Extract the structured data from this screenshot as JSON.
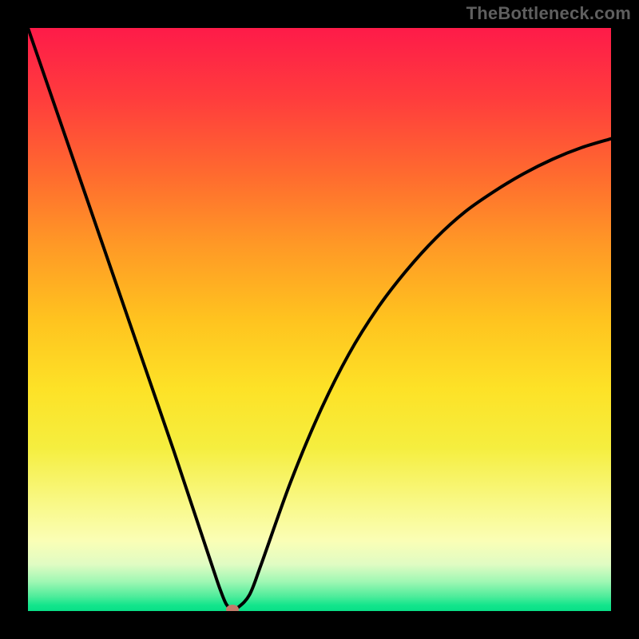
{
  "watermark": "TheBottleneck.com",
  "chart_data": {
    "type": "line",
    "title": "",
    "xlabel": "",
    "ylabel": "",
    "xlim": [
      0,
      100
    ],
    "ylim": [
      0,
      100
    ],
    "grid": false,
    "legend": false,
    "series": [
      {
        "name": "bottleneck-curve",
        "x": [
          0,
          5,
          10,
          15,
          20,
          25,
          28,
          30,
          32,
          33,
          34,
          35,
          36,
          38,
          40,
          45,
          50,
          55,
          60,
          65,
          70,
          75,
          80,
          85,
          90,
          95,
          100
        ],
        "values": [
          100,
          85.5,
          71,
          56.5,
          42,
          27.5,
          18.5,
          12.5,
          6.5,
          3.6,
          1.2,
          0.3,
          0.6,
          2.8,
          8,
          22,
          34,
          44,
          52,
          58.5,
          64,
          68.5,
          72,
          75,
          77.5,
          79.5,
          81
        ]
      }
    ],
    "marker": {
      "name": "bottleneck-point",
      "x": 35,
      "y": 0.3,
      "color": "#c47a6a"
    },
    "background_gradient": {
      "top": "#fe1b49",
      "bottom": "#09df87",
      "note": "red-orange-yellow-green vertical rainbow"
    },
    "curve_color": "#000000"
  }
}
